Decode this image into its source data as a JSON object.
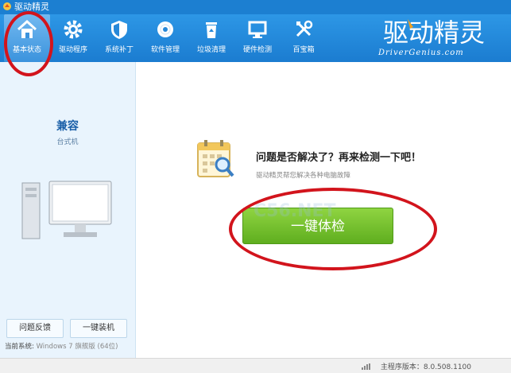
{
  "window": {
    "title": "驱动精灵"
  },
  "toolbar": {
    "items": [
      {
        "label": "基本状态",
        "icon": "home-icon",
        "active": true
      },
      {
        "label": "驱动程序",
        "icon": "gear-icon"
      },
      {
        "label": "系统补丁",
        "icon": "shield-icon"
      },
      {
        "label": "软件管理",
        "icon": "disc-icon"
      },
      {
        "label": "垃圾清理",
        "icon": "recycle-bin-icon"
      },
      {
        "label": "硬件检测",
        "icon": "monitor-icon"
      },
      {
        "label": "百宝箱",
        "icon": "tools-icon"
      }
    ]
  },
  "brand": {
    "name": "驱动精灵",
    "domain": "DriverGenius.com"
  },
  "sidebar": {
    "pc_name": "兼容",
    "pc_type": "台式机",
    "feedback_button": "问题反馈",
    "install_button": "一键装机",
    "system_label": "当前系统:",
    "system_value": "Windows 7 旗舰版 (64位)"
  },
  "main": {
    "question": "问题是否解决了？再来检测一下吧！",
    "subtitle": "驱动精灵帮您解决各种电脑故障",
    "check_button": "一键体检",
    "watermark": "C56.NET"
  },
  "statusbar": {
    "version_label": "主程序版本：",
    "version_value": "8.0.508.1100"
  },
  "colors": {
    "accent": "#1c7fd1",
    "sidebar_bg": "#e9f4fd",
    "button_green": "#6abb26",
    "highlight_red": "#d2141c"
  }
}
